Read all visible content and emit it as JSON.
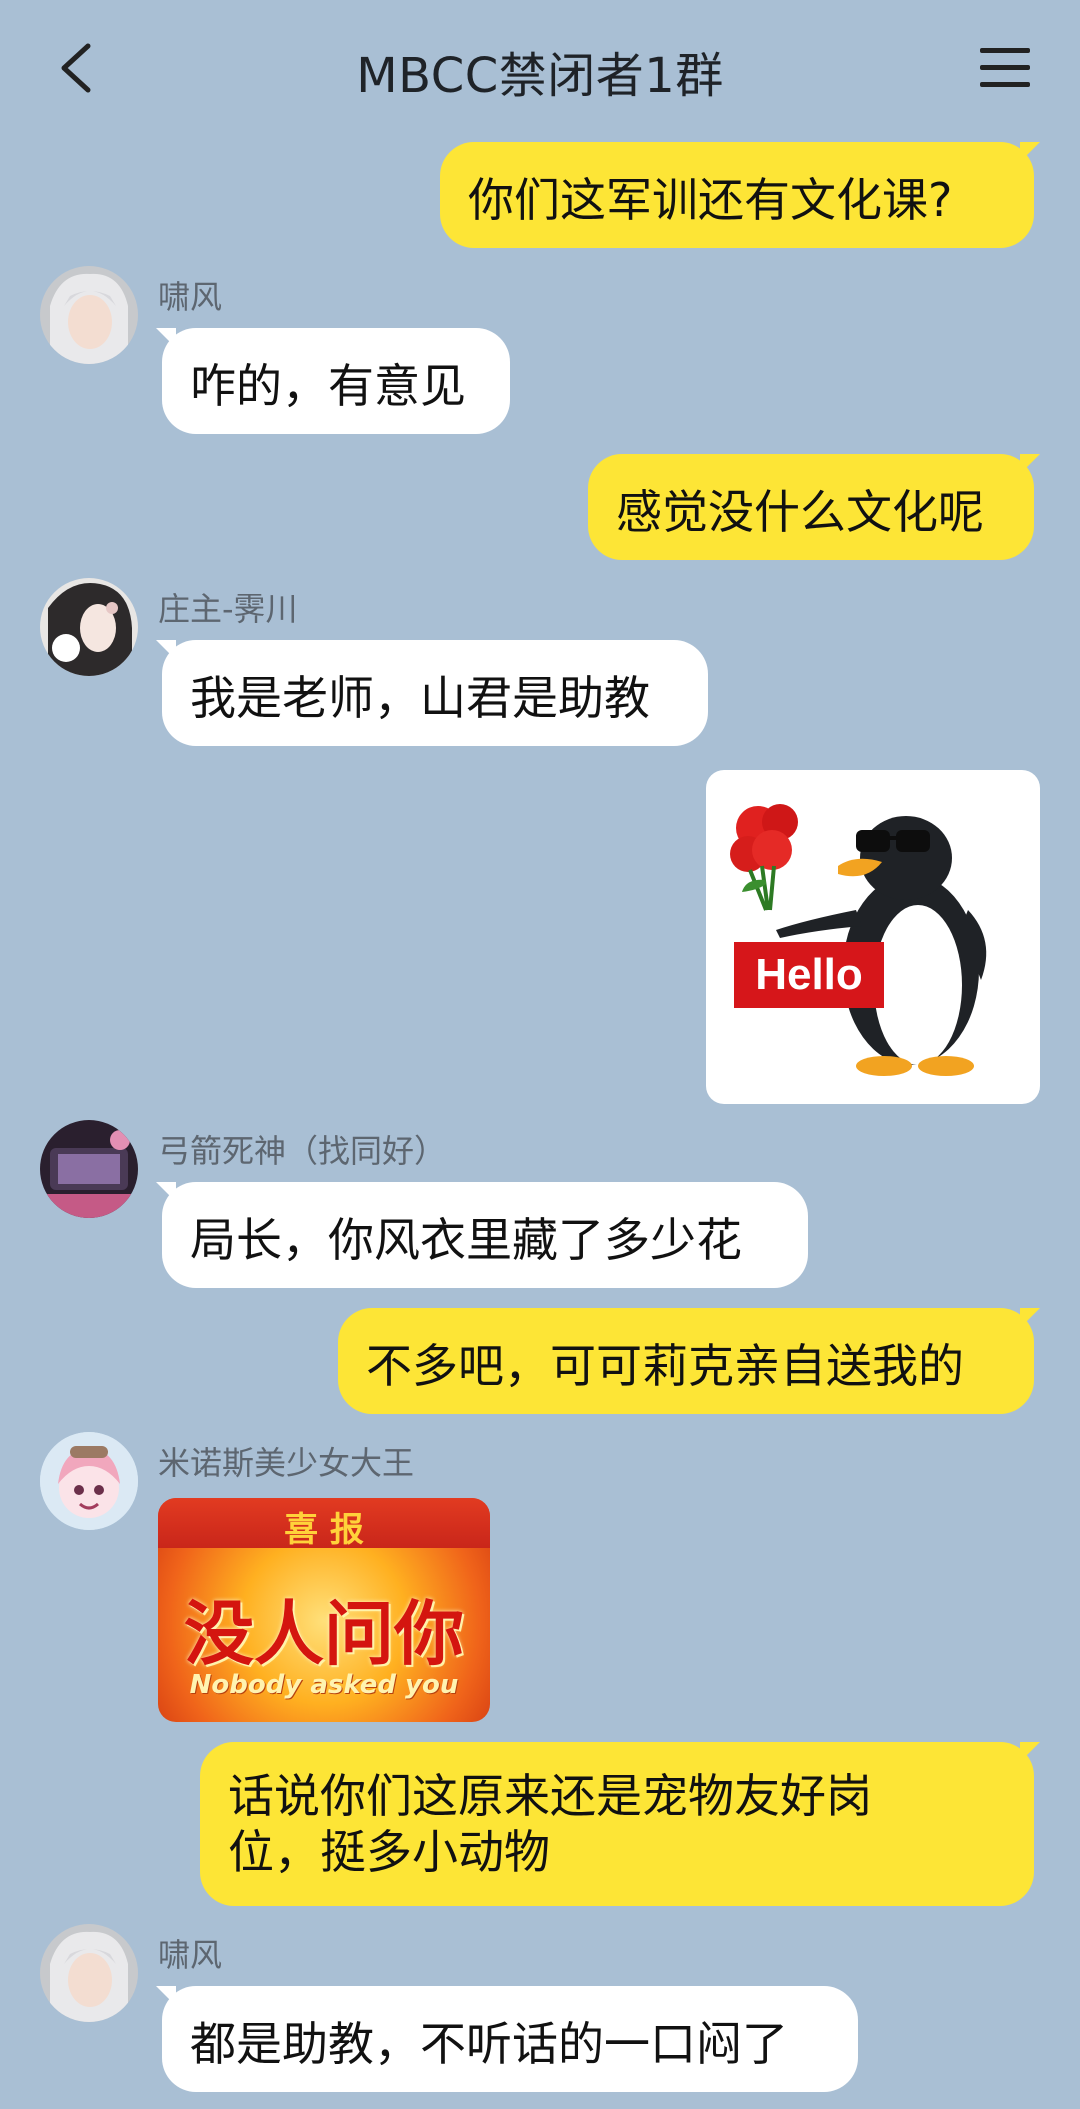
{
  "header": {
    "title": "MBCC禁闭者1群",
    "back_icon": "chevron-left-icon",
    "menu_icon": "hamburger-menu-icon"
  },
  "colors": {
    "background": "#a9bfd4",
    "self_bubble": "#fde536",
    "other_bubble": "#ffffff"
  },
  "messages": [
    {
      "from": "self",
      "text": "你们这军训还有文化课?"
    },
    {
      "from": "other",
      "sender": "啸风",
      "text": "咋的，有意见"
    },
    {
      "from": "self",
      "text": "感觉没什么文化呢"
    },
    {
      "from": "other",
      "sender": "庄主-霁川",
      "text": "我是老师，山君是助教"
    },
    {
      "from": "self",
      "sticker": "penguin-hello-sticker",
      "sticker_text": "Hello"
    },
    {
      "from": "other",
      "sender": "弓箭死神（找同好）",
      "text": "局长，你风衣里藏了多少花"
    },
    {
      "from": "self",
      "text": "不多吧，可可莉克亲自送我的"
    },
    {
      "from": "other",
      "sender": "米诺斯美少女大王",
      "sticker": "nobody-asked-you-sticker",
      "sticker_text": {
        "top": "喜 报",
        "main": "没人问你",
        "sub": "Nobody asked you"
      }
    },
    {
      "from": "self",
      "text": "话说你们这原来还是宠物友好岗位，挺多小动物"
    },
    {
      "from": "other",
      "sender": "啸风",
      "text": "都是助教，不听话的一口闷了"
    }
  ]
}
